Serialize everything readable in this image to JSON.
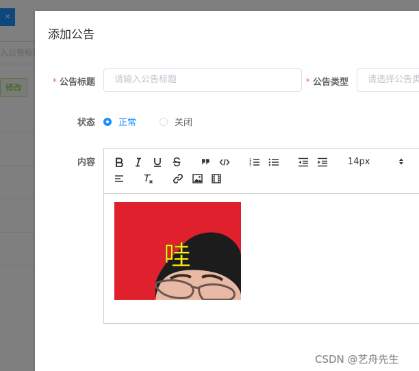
{
  "background": {
    "tab_close": "×",
    "search_placeholder": "入公告标题",
    "edit_button": "修改"
  },
  "dialog": {
    "title": "添加公告",
    "form": {
      "title_label": "公告标题",
      "title_placeholder": "请输入公告标题",
      "type_label": "公告类型",
      "type_placeholder": "请选择公告类型",
      "status_label": "状态",
      "status_options": [
        {
          "label": "正常",
          "checked": true
        },
        {
          "label": "关闭",
          "checked": false
        }
      ],
      "content_label": "内容",
      "required_mark": "*"
    },
    "editor": {
      "font_size": "14px",
      "toolbar_icons": [
        "bold-icon",
        "italic-icon",
        "underline-icon",
        "strike-icon",
        "blockquote-icon",
        "code-block-icon",
        "ordered-list-icon",
        "bullet-list-icon",
        "outdent-icon",
        "indent-icon",
        "align-icon",
        "clean-icon",
        "link-icon",
        "image-icon",
        "video-icon"
      ],
      "image_caption": "哇"
    }
  },
  "watermark": "CSDN @艺舟先生",
  "colors": {
    "primary": "#1890ff",
    "danger": "#f56c6c",
    "image_red": "#e0202c",
    "caption_yellow": "#fff200"
  }
}
